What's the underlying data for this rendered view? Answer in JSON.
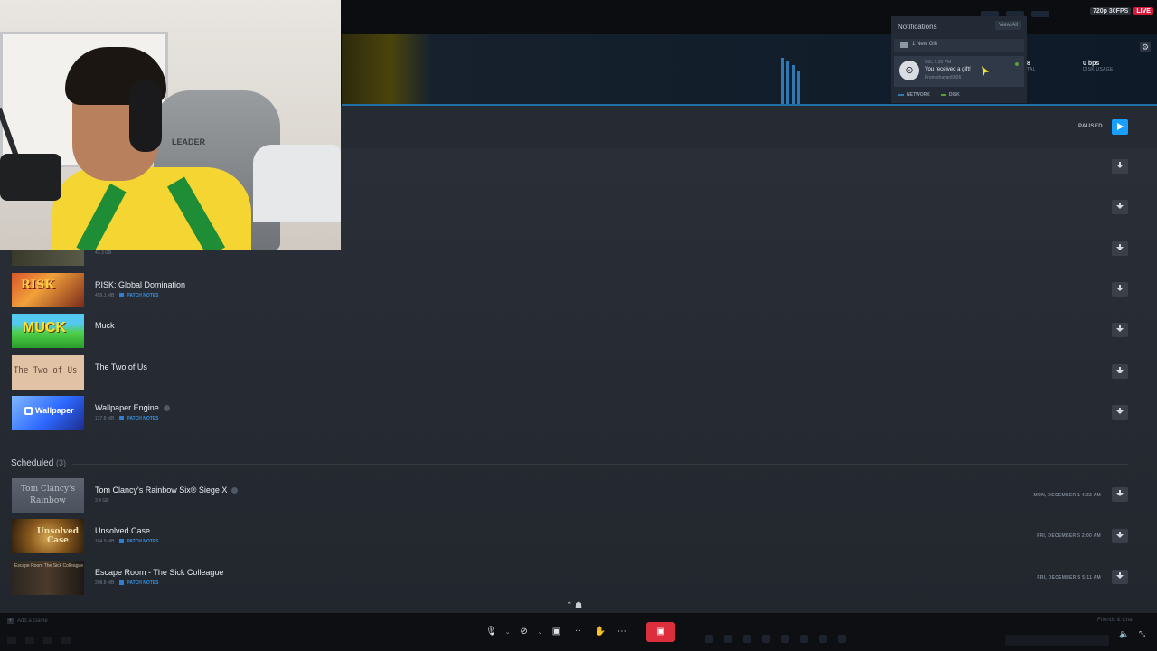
{
  "stream": {
    "quality": "720p 30FPS",
    "live": "LIVE"
  },
  "notifications": {
    "header": "Notifications",
    "view_all": "View All",
    "new_gift": "1 New Gift",
    "item": {
      "meta": "Gift, 7:30 PM",
      "title": "You received a gift!",
      "from": "From shayan5026"
    }
  },
  "stats": {
    "total_value": "8",
    "total_label": "TAL",
    "disk_value": "0 bps",
    "disk_label": "DISK USAGE"
  },
  "legend": {
    "network": "NETWORK",
    "disk": "DISK",
    "network_color": "#2f78b2",
    "disk_color": "#5aa02c"
  },
  "queue": {
    "paused_label": "PAUSED"
  },
  "upcoming": [
    {
      "name": "RISK: Global Domination",
      "size": "459.1 MB",
      "patch_notes": "PATCH NOTES",
      "thumb_text": "RISK"
    },
    {
      "name": "Muck",
      "size": "",
      "patch_notes": "",
      "thumb_text": "MUCK"
    },
    {
      "name": "The Two of Us",
      "size": "",
      "patch_notes": "",
      "thumb_text": "The Two of Us"
    },
    {
      "name": "Wallpaper Engine",
      "size": "137.8 MB",
      "patch_notes": "PATCH NOTES",
      "thumb_text": "Wallpaper"
    }
  ],
  "partial_row_size": "43.3 GB",
  "scheduled": {
    "title": "Scheduled",
    "count": "(3)",
    "items": [
      {
        "name": "Tom Clancy's Rainbow Six® Siege X",
        "size": "3.4 GB",
        "patch_notes": "",
        "date": "MON, DECEMBER 1 4:32 AM",
        "thumb_text": "Tom Clancy's Rainbow"
      },
      {
        "name": "Unsolved Case",
        "size": "164.9 MB",
        "patch_notes": "PATCH NOTES",
        "date": "FRI, DECEMBER 5 2:00 AM",
        "thumb_text": "Unsolved Case"
      },
      {
        "name": "Escape Room - The Sick Colleague",
        "size": "208.8 MB",
        "patch_notes": "PATCH NOTES",
        "date": "FRI, DECEMBER 5 5:11 AM",
        "thumb_text": "Escape Room The Sick Colleague"
      }
    ]
  },
  "footer": {
    "add_game": "Add a Game",
    "friends_chat": "Friends & Chat"
  },
  "webcam": {
    "chair_brand": "LEADER"
  },
  "icons": {
    "settings": "gear-icon",
    "download": "download-icon",
    "play": "play-icon",
    "mic": "microphone-icon",
    "camera": "camera-off-icon",
    "screenshare": "screen-share-icon",
    "grid": "grid-icon",
    "reactions": "hand-icon",
    "more": "more-icon",
    "leave": "leave-call-icon"
  },
  "colors": {
    "accent": "#1a9fff",
    "patch_link": "#3a8edb",
    "leave": "#dc2e3d",
    "live": "#d7193b"
  }
}
